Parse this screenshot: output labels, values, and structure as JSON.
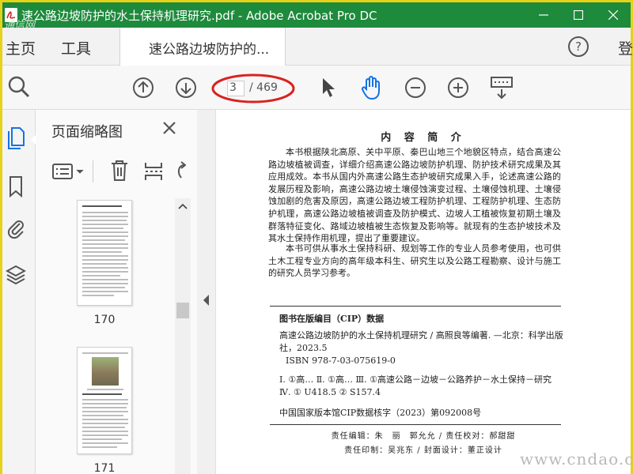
{
  "window": {
    "title": "速公路边坡防护的水土保持机理研究.pdf - Adobe Acrobat Pro DC",
    "overlay_text": "通信网",
    "colors": {
      "titlebar": "#1e8a3c",
      "highlight_ellipse": "#d9221f",
      "accent_blue": "#1473e6"
    }
  },
  "menu": {
    "home": "主页",
    "tools": "工具",
    "doc_tab": "速公路边坡防护的...",
    "signin": "登"
  },
  "toolbar": {
    "current_page": "3",
    "total_pages": "/ 469",
    "icons": [
      "search-icon",
      "page-up-icon",
      "page-down-icon",
      "select-arrow-icon",
      "hand-icon",
      "zoom-out-icon",
      "zoom-in-icon",
      "marquee-zoom-icon"
    ]
  },
  "thumbnails": {
    "title": "页面缩略图",
    "items": [
      {
        "label": "170"
      },
      {
        "label": "171"
      }
    ]
  },
  "document": {
    "heading": "内 容 简 介",
    "para1": "本书根据陕北高原、关中平原、秦巴山地三个地貌区特点，结合高速公路边坡植被调查，详细介绍高速公路边坡防护机理、防护技术研究成果及其应用成效。本书从国内外高速公路生态护坡研究成果入手，论述高速公路的发展历程及影响，高速公路边坡土壤侵蚀演变过程、土壤侵蚀机理、土壤侵蚀加剧的危害及原因，高速公路边坡工程防护机理、工程防护机理、生态防护机理，高速公路边坡植被调查及防护模式、边坡人工植被恢复初期土壤及群落特征变化、路域边坡植被生态恢复及影响等。就现有的生态护坡技术及其水土保持作用机理，提出了重要建议。",
    "para2": "本书可供从事水土保持科研、规划等工作的专业人员参考使用，也可供土木工程专业方向的高年级本科生、研究生以及公路工程勘察、设计与施工的研究人员学习参考。",
    "cip_title": "图书在版编目（CIP）数据",
    "cip_line1": "高速公路边坡防护的水土保持机理研究 / 高照良等编著. —北京：科学出版社，2023.5",
    "cip_line2": "ISBN 978-7-03-075619-0",
    "cip_line3": "Ⅰ. ①高…  Ⅱ. ①高…  Ⅲ. ①高速公路－边坡－公路养护－水土保持－研究  Ⅳ. ① U418.5 ② S157.4",
    "cip_line4": "中国国家版本馆CIP数据核字（2023）第092008号",
    "credit1": "责任编辑：朱　丽　郭允允 / 责任校对：郝甜甜",
    "credit2": "责任印制：吴兆东 / 封面设计：董正设计"
  },
  "watermark": "www.cndao.com"
}
